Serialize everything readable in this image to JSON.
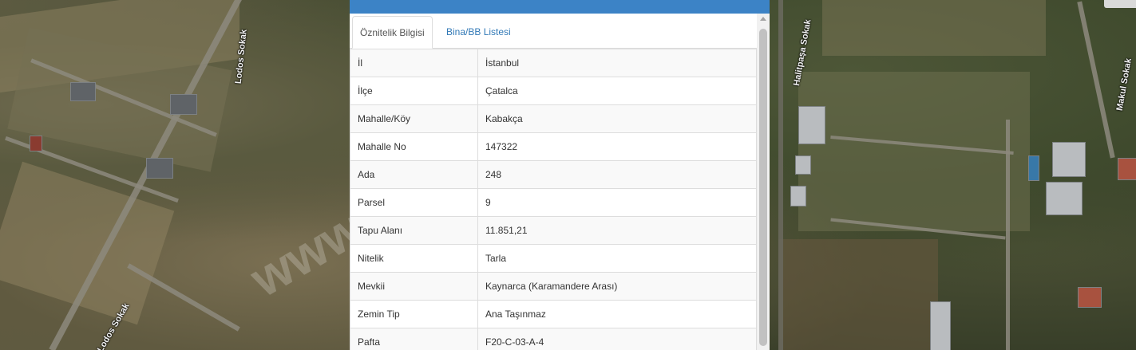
{
  "map": {
    "street_labels": [
      "Lodos Sokak",
      "Lodos Sokak",
      "Halitpaşa Sokak",
      "Makul Sokak"
    ],
    "watermark": "www.emlakpet.com"
  },
  "panel": {
    "tabs": [
      {
        "label": "Öznitelik Bilgisi",
        "active": true
      },
      {
        "label": "Bina/BB Listesi",
        "active": false
      }
    ],
    "rows": [
      {
        "key": "İl",
        "value": "İstanbul"
      },
      {
        "key": "İlçe",
        "value": "Çatalca"
      },
      {
        "key": "Mahalle/Köy",
        "value": "Kabakça"
      },
      {
        "key": "Mahalle No",
        "value": "147322"
      },
      {
        "key": "Ada",
        "value": "248"
      },
      {
        "key": "Parsel",
        "value": "9"
      },
      {
        "key": "Tapu Alanı",
        "value": "11.851,21"
      },
      {
        "key": "Nitelik",
        "value": "Tarla"
      },
      {
        "key": "Mevkii",
        "value": "Kaynarca (Karamandere Arası)"
      },
      {
        "key": "Zemin Tip",
        "value": "Ana Taşınmaz"
      },
      {
        "key": "Pafta",
        "value": "F20-C-03-A-4"
      }
    ]
  },
  "colors": {
    "header": "#3c83c6",
    "link": "#337ab7",
    "border": "#dddddd"
  }
}
